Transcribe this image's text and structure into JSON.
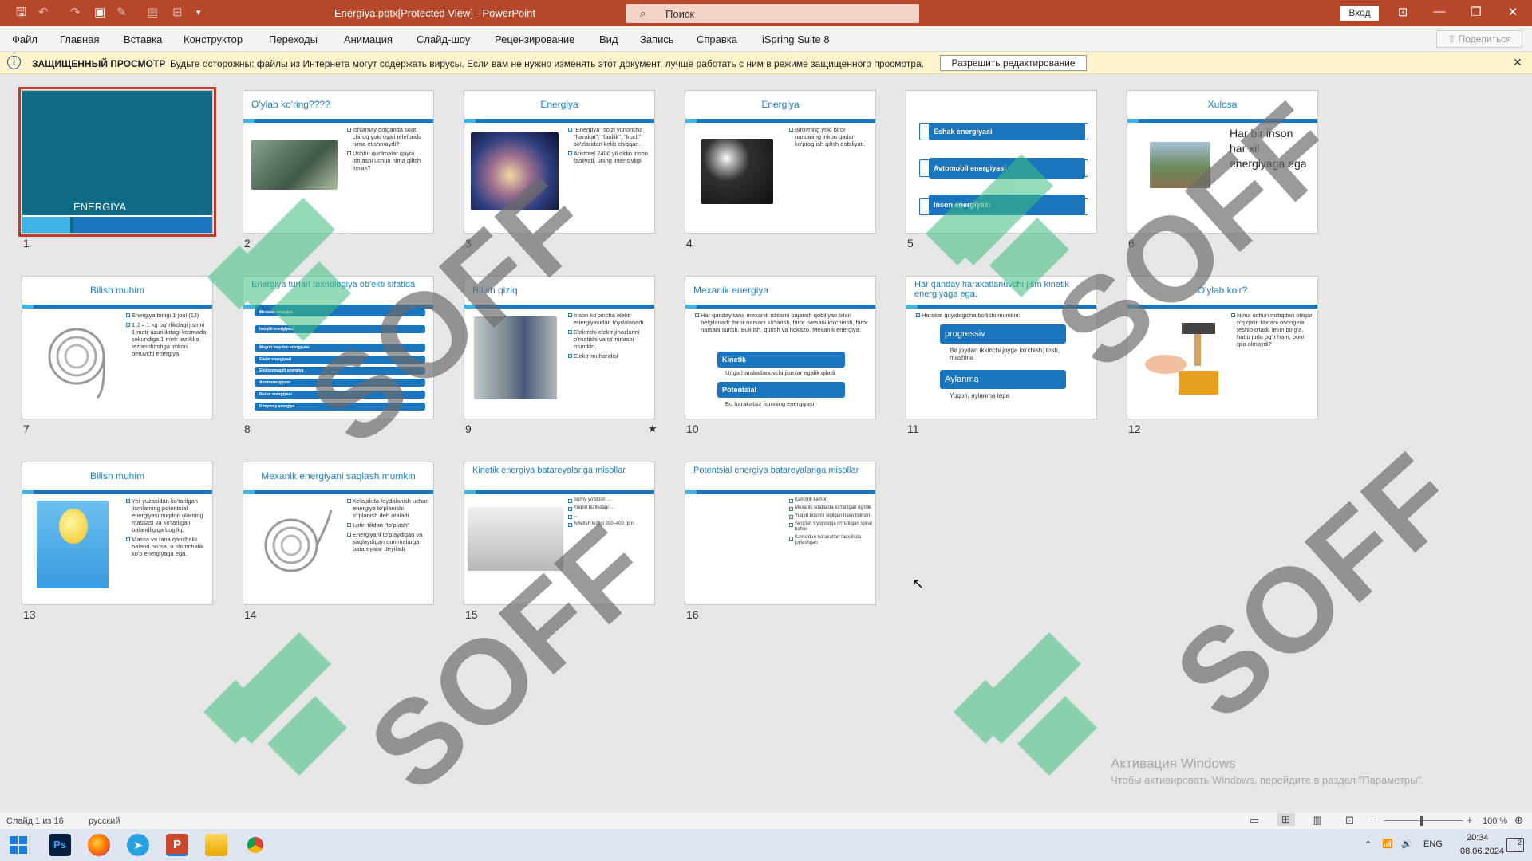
{
  "window": {
    "doc_title": "Energiya.pptx[Protected View] - PowerPoint",
    "search_placeholder": "Поиск",
    "signin": "Вход"
  },
  "ribbon": {
    "tabs": [
      "Файл",
      "Главная",
      "Вставка",
      "Конструктор",
      "Переходы",
      "Анимация",
      "Слайд-шоу",
      "Рецензирование",
      "Вид",
      "Запись",
      "Справка",
      "iSpring Suite 8"
    ],
    "share": "Поделиться"
  },
  "message_bar": {
    "title": "ЗАЩИЩЕННЫЙ ПРОСМОТР",
    "text": "Будьте осторожны: файлы из Интернета могут содержать вирусы. Если вам не нужно изменять этот документ, лучше работать с ним в режиме защищенного просмотра.",
    "button": "Разрешить редактирование",
    "accent_color": "#fff4ce"
  },
  "slides": [
    {
      "num": "1",
      "title": "ENERGIYA"
    },
    {
      "num": "2",
      "title": "O'ylab ko'ring????",
      "bullets": [
        "Ishlamay qolganda soat, chiroq yoki uyali telefonda nima etishmaydi?",
        "Ushbu qurilmalar qayta ishlashi uchun nima qilish kerak?"
      ]
    },
    {
      "num": "3",
      "title": "Energiya",
      "bullets": [
        "\"Energiya\" so'zi yunoncha \"harakat\", \"faollik\", \"kuch\" so'zlaridan kelib chiqqan.",
        "Aristotel 2400 yil oldin inson faoliyati, uning intensivligi"
      ]
    },
    {
      "num": "4",
      "title": "Energiya",
      "bullets": [
        "Birovning yoki biror narsaning inkon qadar ko'prog ish qilish qobiliyati."
      ]
    },
    {
      "num": "5",
      "items": [
        "Eshak energiyasi",
        "Avtomobil energiyasi",
        "Inson energiyasi"
      ]
    },
    {
      "num": "6",
      "title": "Xulosa",
      "text": "Har bir inson har xil energiyaga ega"
    },
    {
      "num": "7",
      "title": "Bilish muhim",
      "bullets": [
        "Energiya birligi 1 joul (1J)",
        "1 J = 1 kg og'irlikdagi jismni 1 metr uzunlikdagi kesmada sekundiga 1 metr tezlikka tezlashtirishga imkon beruvchi energiya."
      ]
    },
    {
      "num": "8",
      "title": "Energiya turlari texnologiya ob'ekti sifatida",
      "rows": [
        "Mexanik energiya",
        "Issiqlik energiyasi",
        "Magnit maydon energiyasi",
        "Elektr energiyasi",
        "Elektromagnit energiya",
        "Atom energiyasi",
        "Nurlar energiyasi",
        "Kimyoviy energiya"
      ]
    },
    {
      "num": "9",
      "title": "Bilish qiziq",
      "bullets": [
        "Inson ko'pincha elektr energiyasidan foydalanadi.",
        "Elektrchi elektr jihozlarini o'rnatishi va ta'mirlashi mumkin.",
        "Elektr muhandisi"
      ]
    },
    {
      "num": "10",
      "title": "Mexanik energiya",
      "intro": "Har qanday tana mexanik ishlarni bajarish qobiliyati bilan belgilanadi: biror narsani ko'tarish, biror narsani ko'chirish, biror narsani surish. Buklish, qurish va hokazo. Mexanik energiya:",
      "boxes": [
        "Kinetik",
        "Potentsial"
      ],
      "subs": [
        "Unga harakatlanuvchi jismlar egalik qiladi",
        "Bu harakatsiz jismning energiyasi"
      ]
    },
    {
      "num": "11",
      "title": "Har qanday harakatlanuvchi jism kinetik energiyaga ega.",
      "intro": "Harakat quyidagicha bo'lishi mumkin:",
      "boxes": [
        "progressiv",
        "Aylanma"
      ],
      "subs": [
        "Bir joydan ikkinchi joyga ko'chish; tosh, mashina",
        "Yuqori, aylanma tepa"
      ]
    },
    {
      "num": "12",
      "title": "O'ylab ko'r?",
      "bullets": [
        "Nima uchun miltiqdan otilgan o'q qalin taxtani osongina teshib o'tadi, lekin bolg'a, hatto juda og'ir ham, buni qila olmaydi?"
      ]
    },
    {
      "num": "13",
      "title": "Bilish muhim",
      "bullets": [
        "Yer yuzasidan ko'tarilgan jismlarning potentsial energiyasi miqdori ularning massasi va ko'tarilgan balandligiga bog'liq.",
        "Massa va tana qanchalik baland bo'lsa, u shunchalik ko'p energiyaga ega."
      ]
    },
    {
      "num": "14",
      "title": "Mexanik energiyani saqlash mumkin",
      "bullets": [
        "Kelajakda foydalanish uchun energiya to'planishi to'planish deb ataladi.",
        "Lotin tilidan \"to'plash\"",
        "Energiyani to'playdigan va saqlaydigan qurilmalarga batareyalar deyiladi."
      ]
    },
    {
      "num": "15",
      "title": "Kinetik energiya batareyalariga misollar",
      "bullets": [
        "Sun'iy yo'ldosh …",
        "Yuqori tezlikdagi …",
        "…",
        "Ayletish tezligi 200–400 rpm."
      ]
    },
    {
      "num": "16",
      "title": "Potentsial energiya batareyalariga misollar",
      "bullets": [
        "Kamonli kamon",
        "Mexanik soatlarda ko'tarilgan og'irlik",
        "Yuqori bosimli siqilgan havo tsilindri",
        "Serg'ish s'yiqnoqqa o'rnatilgan spiral bahor",
        "Kamo'dun harakatlari taqsilikda joylashgan"
      ]
    }
  ],
  "activation": {
    "title": "Активация Windows",
    "subtitle": "Чтобы активировать Windows, перейдите в раздел \"Параметры\"."
  },
  "status": {
    "slide_counter": "Слайд 1 из 16",
    "language": "русский",
    "zoom": "100 %"
  },
  "taskbar": {
    "lang": "ENG",
    "time": "20:34",
    "date": "08.06.2024",
    "notifications": "2"
  }
}
